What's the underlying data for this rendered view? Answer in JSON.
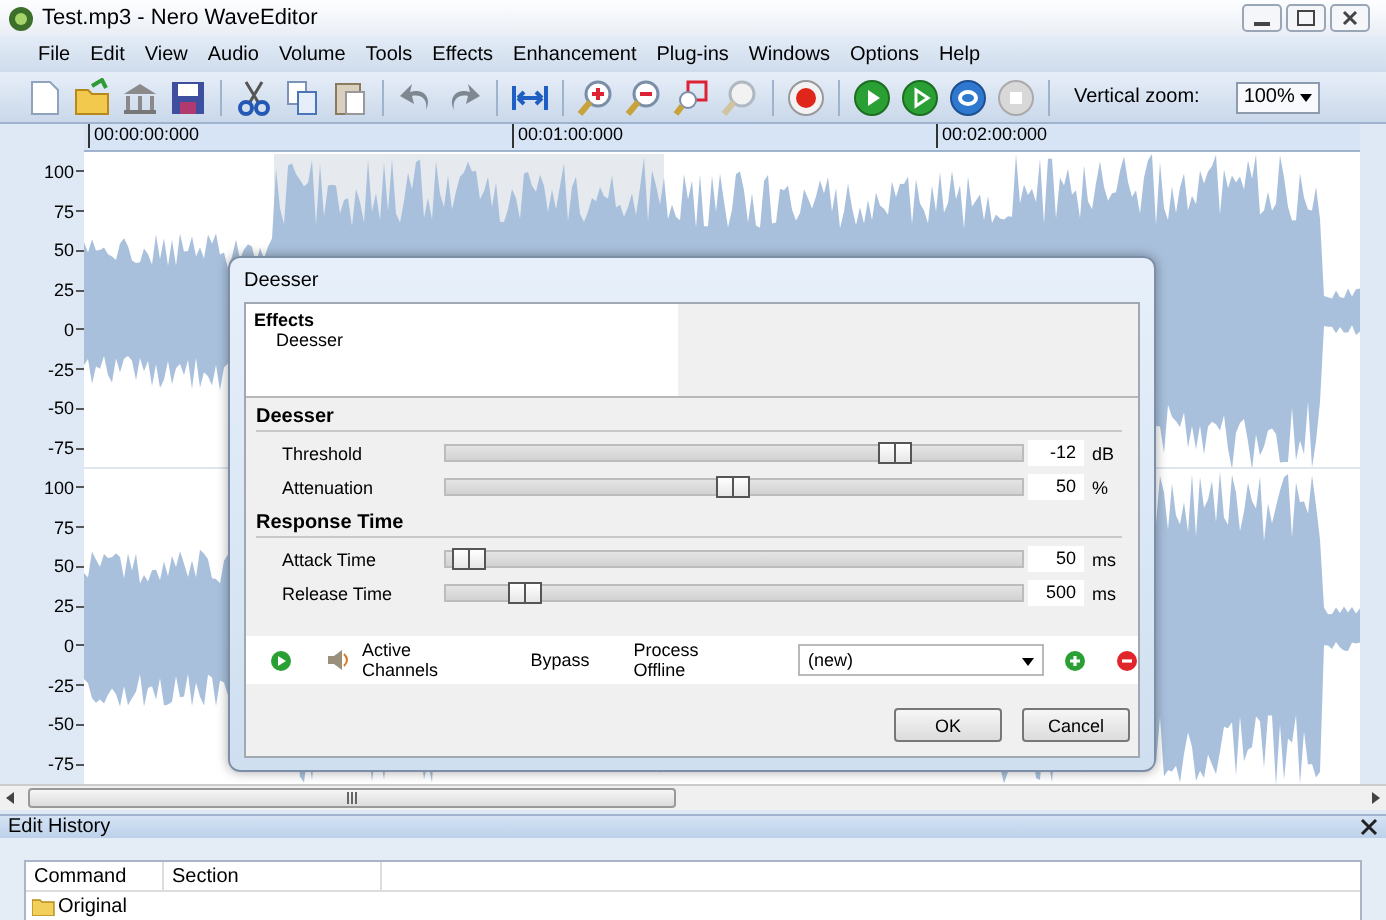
{
  "window": {
    "title": "Test.mp3 - Nero WaveEditor"
  },
  "menu": [
    "File",
    "Edit",
    "View",
    "Audio",
    "Volume",
    "Tools",
    "Effects",
    "Enhancement",
    "Plug-ins",
    "Windows",
    "Options",
    "Help"
  ],
  "vertical_zoom": {
    "label": "Vertical zoom:",
    "value": "100%"
  },
  "ruler": [
    "00:00:00:000",
    "00:01:00:000",
    "00:02:00:000"
  ],
  "y_axis": [
    "100",
    "75",
    "50",
    "25",
    "0",
    "-25",
    "-50",
    "-75",
    "100",
    "75",
    "50",
    "25",
    "0",
    "-25",
    "-50",
    "-75"
  ],
  "dialog": {
    "title": "Deesser",
    "tree": {
      "heading": "Effects",
      "items": [
        "Deesser"
      ]
    },
    "sections": [
      {
        "title": "Deesser",
        "params": [
          {
            "label": "Threshold",
            "value": "-12",
            "unit": "dB",
            "level": 0.78
          },
          {
            "label": "Attenuation",
            "value": "50",
            "unit": "%",
            "level": 0.5
          }
        ]
      },
      {
        "title": "Response Time",
        "params": [
          {
            "label": "Attack Time",
            "value": "50",
            "unit": "ms",
            "level": 0.04
          },
          {
            "label": "Release Time",
            "value": "500",
            "unit": "ms",
            "level": 0.14
          }
        ]
      }
    ],
    "footer": {
      "active_channels": "Active Channels",
      "bypass": "Bypass",
      "process_offline": "Process Offline",
      "preset": "(new)"
    },
    "buttons": [
      "OK",
      "Cancel"
    ]
  },
  "edit_history": {
    "title": "Edit History",
    "columns": [
      "Command",
      "Section"
    ],
    "rows": [
      {
        "command": "Original"
      }
    ]
  }
}
